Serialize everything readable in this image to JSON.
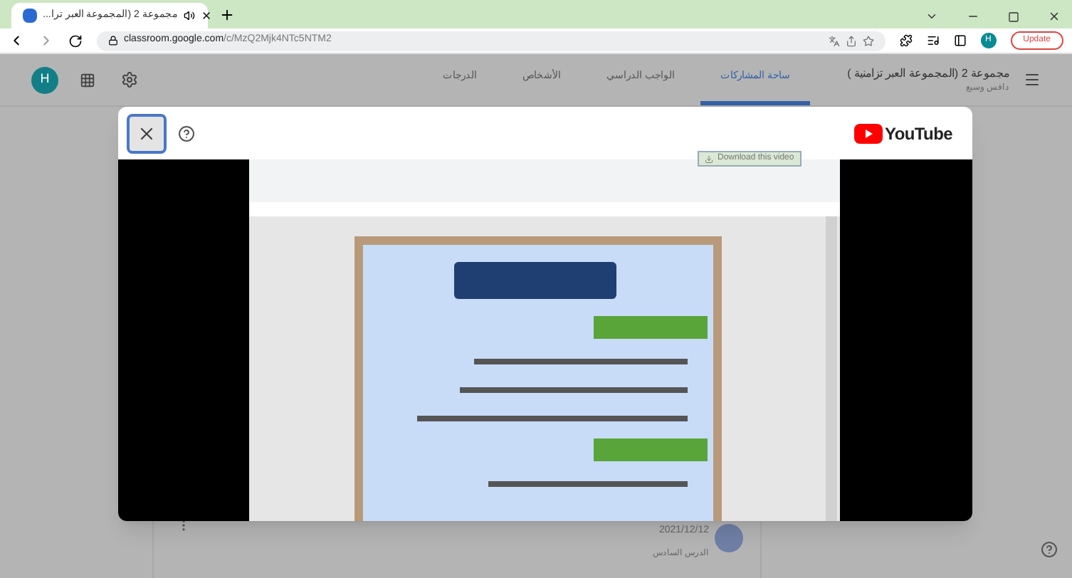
{
  "browser": {
    "tab": {
      "title": "مجموعة 2 (المجموعة العبر ترا...",
      "selected": true
    },
    "url_host": "classroom.google.com",
    "url_path": "/c/MzQ2Mjk4NTc5NTM2",
    "profile_initial": "H",
    "update_label": "Update"
  },
  "classroom": {
    "user_initial": "H",
    "tabs": [
      {
        "label": "ساحة المشاركات",
        "selected": true
      },
      {
        "label": "الواجب الدراسي",
        "selected": false
      },
      {
        "label": "الأشخاص",
        "selected": false
      },
      {
        "label": "الدرجات",
        "selected": false
      }
    ],
    "class_title": "مجموعة 2 (المجموعة العبر تزامنية )",
    "class_subtitle": "دافس وسيع"
  },
  "dialog": {
    "brand": "YouTube",
    "download_label": "Download this video"
  },
  "post": {
    "date": "2021/12/12",
    "title": "الدرس السادس"
  }
}
